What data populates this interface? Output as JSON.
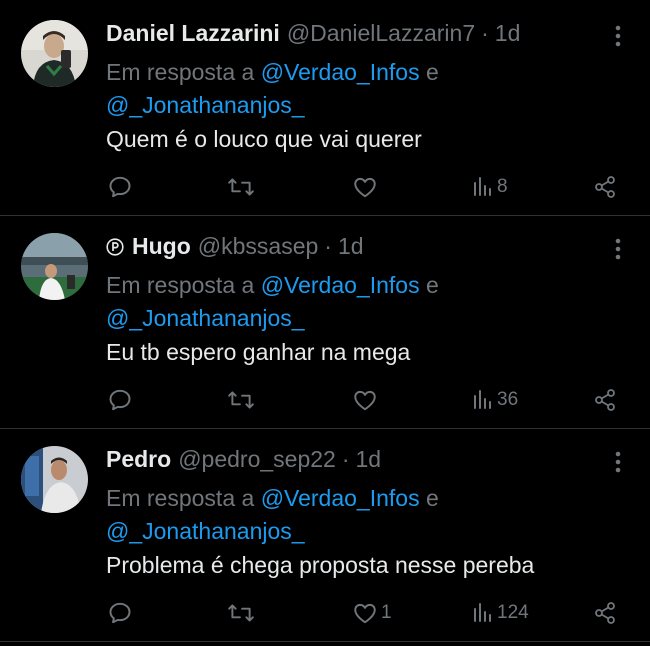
{
  "colors": {
    "background": "#000000",
    "primary_text": "#e7e9ea",
    "secondary_text": "#71767b",
    "mention": "#1d9bf0",
    "divider": "#2f3336"
  },
  "tweets": [
    {
      "display_name": "Daniel Lazzarini",
      "handle": "@DanielLazzarin7",
      "separator": "·",
      "time": "1d",
      "reply_prefix": "Em resposta a ",
      "mention_1": "@Verdao_Infos",
      "conjunction": " e ",
      "mention_2": "@_Jonathananjos_",
      "text": "Quem é o louco que vai querer",
      "replies": "",
      "retweets": "",
      "likes": "",
      "views": "8",
      "avatar_icon": "user-avatar"
    },
    {
      "display_name": "Hugo",
      "badge_icon": "p-circle-icon",
      "handle": "@kbssasep",
      "separator": "·",
      "time": "1d",
      "reply_prefix": "Em resposta a ",
      "mention_1": "@Verdao_Infos",
      "conjunction": " e ",
      "mention_2": "@_Jonathananjos_",
      "text": "Eu tb espero ganhar na mega",
      "replies": "",
      "retweets": "",
      "likes": "",
      "views": "36",
      "avatar_icon": "user-avatar"
    },
    {
      "display_name": "Pedro",
      "handle": "@pedro_sep22",
      "separator": "·",
      "time": "1d",
      "reply_prefix": "Em resposta a ",
      "mention_1": "@Verdao_Infos",
      "conjunction": " e ",
      "mention_2": "@_Jonathananjos_",
      "text": "Problema é chega proposta nesse pereba",
      "replies": "",
      "retweets": "",
      "likes": "1",
      "views": "124",
      "avatar_icon": "user-avatar"
    }
  ],
  "action_icons": [
    "reply-icon",
    "retweet-icon",
    "like-icon",
    "views-icon",
    "share-icon"
  ]
}
